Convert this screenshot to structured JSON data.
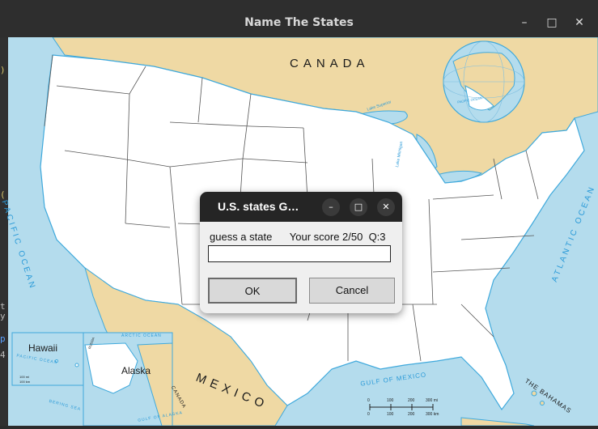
{
  "window": {
    "title": "Name The States",
    "controls": {
      "minimize": "–",
      "maximize": "□",
      "close": "✕"
    }
  },
  "background_code": {
    "glyphs": [
      ")",
      "(",
      "t",
      "y",
      "p",
      "4"
    ]
  },
  "map": {
    "labels": {
      "canada": "CANADA",
      "mexico": "MEXICO",
      "hawaii": "Hawaii",
      "alaska": "Alaska",
      "pacific_ocean": "PACIFIC OCEAN",
      "atlantic_ocean": "ATLANTIC OCEAN",
      "gulf_of_mexico": "GULF OF MEXICO",
      "the_bahamas": "THE BAHAMAS",
      "arctic_ocean": "ARCTIC OCEAN",
      "pacific_ocean_inset": "PACIFIC OCEAN",
      "canada_inset": "CANADA",
      "bering_sea": "BERING SEA",
      "gulf_of_alaska": "GULF OF ALASKA",
      "lake_superior": "Lake Superior",
      "lake_michigan": "Lake Michigan",
      "russia": "RUSSIA",
      "globe_pacific": "PACIFIC OCEAN"
    },
    "scale": {
      "ticks": [
        "0",
        "100",
        "200",
        "300 mi"
      ],
      "ticks_km": [
        "0",
        "100",
        "200",
        "300 km"
      ]
    },
    "hawaii_scale": {
      "mi": "100 mi",
      "km": "100 km"
    },
    "colors": {
      "water": "#b4dced",
      "land_foreign": "#efd9a4",
      "land_us": "#ffffff",
      "border": "#555555",
      "coast": "#3fa9dc"
    }
  },
  "dialog": {
    "title": "U.S. states G…",
    "prompt": "guess a state",
    "score": "Your score 2/50  Q:3",
    "input_value": "",
    "ok_label": "OK",
    "cancel_label": "Cancel",
    "controls": {
      "minimize": "–",
      "maximize": "□",
      "close": "✕"
    }
  }
}
